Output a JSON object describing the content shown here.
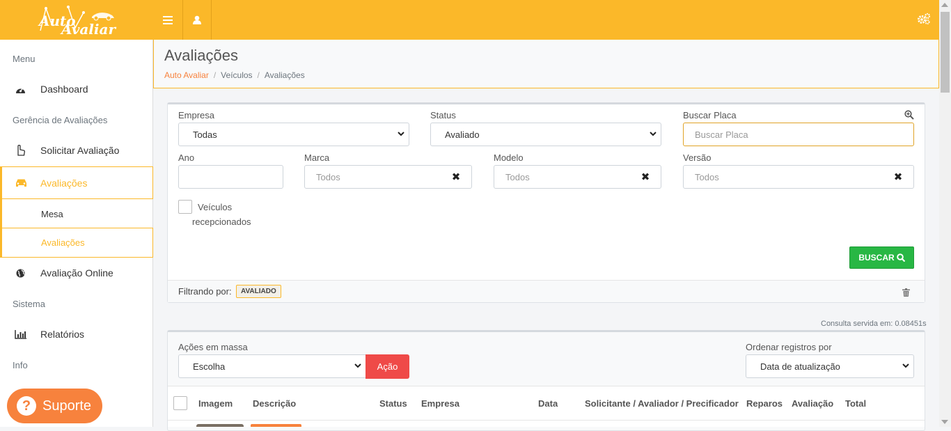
{
  "app": {
    "logo_line1": "Auto",
    "logo_line2": "Avaliar"
  },
  "sidebar": {
    "sections": [
      "Menu",
      "Gerência de Avaliações",
      "Sistema",
      "Info"
    ],
    "items": {
      "dashboard": "Dashboard",
      "solicitar": "Solicitar Avaliação",
      "avaliacoes": "Avaliações",
      "mesa": "Mesa",
      "avaliacoes_sub": "Avaliações",
      "online": "Avaliação Online",
      "relatorios": "Relatórios"
    }
  },
  "support": {
    "label": "Suporte",
    "icon": "?"
  },
  "header": {
    "title": "Avaliações",
    "breadcrumb": [
      "Auto Avaliar",
      "Veículos",
      "Avaliações"
    ]
  },
  "filters": {
    "empresa_label": "Empresa",
    "empresa_value": "Todas",
    "status_label": "Status",
    "status_value": "Avaliado",
    "placa_label": "Buscar Placa",
    "placa_placeholder": "Buscar Placa",
    "ano_label": "Ano",
    "marca_label": "Marca",
    "marca_placeholder": "Todos",
    "modelo_label": "Modelo",
    "modelo_placeholder": "Todos",
    "versao_label": "Versão",
    "versao_placeholder": "Todos",
    "recepcionados_line1": "Veículos",
    "recepcionados_line2": "recepcionados",
    "buscar_label": "BUSCAR",
    "filtrando_label": "Filtrando por:",
    "filtrando_badge": "AVALIADO",
    "clear_symbol": "✖"
  },
  "query_time": "Consulta servida em: 0.08451s",
  "mass_actions": {
    "label": "Ações em massa",
    "select_value": "Escolha",
    "action_button": "Ação"
  },
  "order": {
    "label": "Ordenar registros por",
    "value": "Data de atualização"
  },
  "table": {
    "headers": [
      "Imagem",
      "Descrição",
      "Status",
      "Empresa",
      "Data",
      "Solicitante / Avaliador / Precificador",
      "Reparos",
      "Avaliação",
      "Total"
    ]
  },
  "colors": {
    "brand": "#fbb829",
    "accent": "#f7823d",
    "success": "#28b744",
    "danger": "#ef4a48"
  }
}
